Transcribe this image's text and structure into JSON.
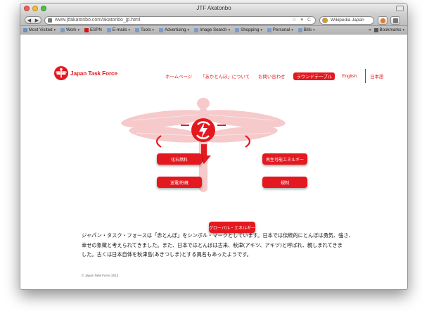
{
  "window": {
    "title": "JTF Akatonbo"
  },
  "browser": {
    "url": "www.jtfakatonbo.com/akatonbo_jp.html",
    "search_placeholder": "Wikipedia Japan",
    "back_glyph": "◀",
    "forward_glyph": "▶"
  },
  "bookmarks": {
    "items": [
      {
        "label": "Most Visited",
        "caret": "▾"
      },
      {
        "label": "Work",
        "caret": "▾"
      },
      {
        "label": "ESPN",
        "caret": ""
      },
      {
        "label": "E-mails",
        "caret": "▾"
      },
      {
        "label": "Tools",
        "caret": "▾"
      },
      {
        "label": "Advertising",
        "caret": "▾"
      },
      {
        "label": "Image Search",
        "caret": "▾"
      },
      {
        "label": "Shopping",
        "caret": "▾"
      },
      {
        "label": "Personal",
        "caret": "▾"
      },
      {
        "label": "Bills",
        "caret": "▾"
      }
    ],
    "overflow": "»",
    "bookmarks_label": "Bookmarks"
  },
  "site": {
    "logo_text": "Japan Task Force",
    "nav": [
      {
        "label": "ホームページ"
      },
      {
        "label": "「あかとんぼ」について"
      },
      {
        "label": "お問い合わせ"
      }
    ],
    "nav_active": "ラウンドテーブル",
    "lang_en": "English",
    "lang_ja": "日本語"
  },
  "diagram": {
    "fossil": "化石燃料",
    "renewable": "再生可能エネルギー",
    "storage": "送電/貯蔵",
    "regulation": "規制",
    "global": "グローバル・エネルギー"
  },
  "body": {
    "line1": "ジャパン・タスク・フォースは「赤とんぼ」をシンボル・マークとしています。日本では伝統的にとんぼは勇気、強さ、",
    "line2": "幸せの象徴と考えられてきました。また、日本ではとんぼは古来、秋津(アキツ、アキヅ)と呼ばれ、親しまれてきま",
    "line3": "した。古くは日本自体を秋津島(あきつしま)とする異名もあったようです。",
    "copyright": "© Japan Task Force 2013"
  },
  "colors": {
    "brand_red": "#e4181f",
    "dragonfly_pink": "#f6c9ca"
  }
}
